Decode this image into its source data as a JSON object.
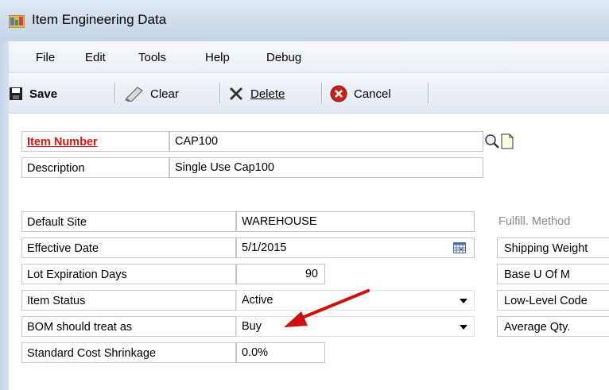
{
  "window": {
    "title": "Item Engineering Data"
  },
  "menu": {
    "items": [
      "File",
      "Edit",
      "Tools",
      "Help",
      "Debug"
    ]
  },
  "toolbar": {
    "save_label": "Save",
    "clear_label": "Clear",
    "delete_label": "Delete",
    "cancel_label": "Cancel"
  },
  "form": {
    "item_number_label": "Item Number",
    "item_number_value": "CAP100",
    "description_label": "Description",
    "description_value": "Single Use Cap100",
    "default_site_label": "Default Site",
    "default_site_value": "WAREHOUSE",
    "effective_date_label": "Effective Date",
    "effective_date_value": "5/1/2015",
    "lot_expiration_label": "Lot Expiration Days",
    "lot_expiration_value": "90",
    "item_status_label": "Item Status",
    "item_status_value": "Active",
    "bom_treat_label": "BOM should treat as",
    "bom_treat_value": "Buy",
    "std_cost_shrink_label": "Standard Cost Shrinkage",
    "std_cost_shrink_value": "0.0%"
  },
  "right_panel": {
    "fulfill_method": "Fulfill. Method",
    "shipping_weight": "Shipping Weight",
    "base_uofm": "Base U Of M",
    "low_level_code": "Low-Level Code",
    "average_qty": "Average Qty."
  },
  "colors": {
    "accent_red": "#d9160f",
    "arrow": "#cc1111"
  },
  "icons": [
    "app-icon",
    "save-icon",
    "clear-icon",
    "delete-icon",
    "cancel-icon",
    "lookup-icon",
    "note-icon",
    "calendar-icon",
    "dropdown-icon",
    "annotation-arrow"
  ]
}
